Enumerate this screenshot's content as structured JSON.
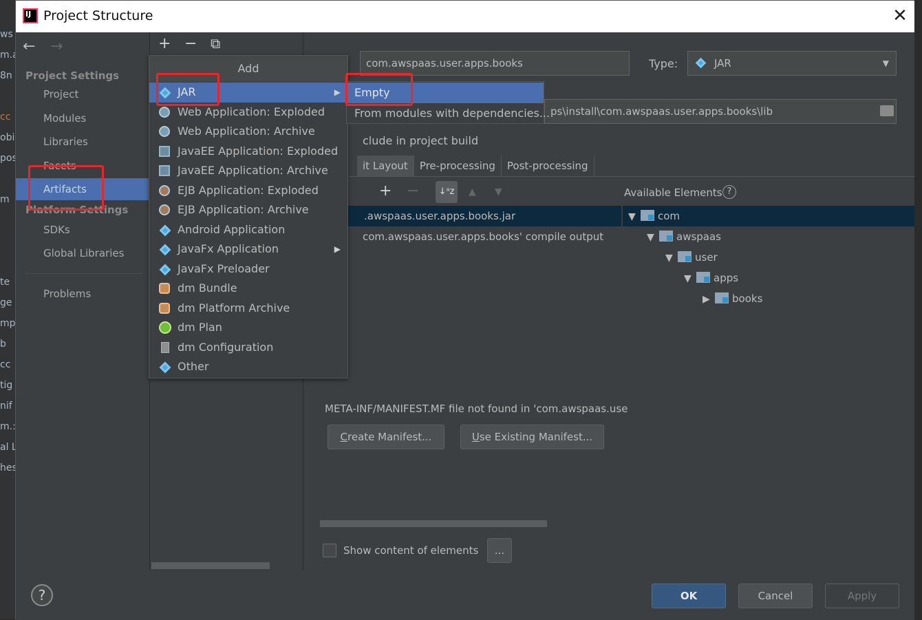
{
  "ide_background": {
    "left_fragments": [
      "ws",
      "m.a",
      "8n",
      "cc",
      "obil",
      "pos",
      "m",
      "te",
      "ge",
      "mp",
      "b",
      "cc",
      "tig",
      "nif",
      "m.:",
      "al L",
      "hes"
    ]
  },
  "dialog": {
    "title": "Project Structure",
    "close_glyph": "✕"
  },
  "nav": {
    "back_glyph": "←",
    "forward_glyph": "→",
    "project_settings_header": "Project Settings",
    "project_items": [
      "Project",
      "Modules",
      "Libraries",
      "Facets",
      "Artifacts"
    ],
    "selected": "Artifacts",
    "platform_settings_header": "Platform Settings",
    "platform_items": [
      "SDKs",
      "Global Libraries"
    ],
    "problems": "Problems"
  },
  "artifacts_toolbar": {
    "add_glyph": "+",
    "remove_glyph": "−",
    "copy_glyph": "⧉"
  },
  "add_popup": {
    "title": "Add",
    "items": [
      {
        "label": "JAR",
        "icon": "jar-icon",
        "submenu": true,
        "selected": true
      },
      {
        "label": "Web Application: Exploded",
        "icon": "web-app-icon"
      },
      {
        "label": "Web Application: Archive",
        "icon": "web-app-icon"
      },
      {
        "label": "JavaEE Application: Exploded",
        "icon": "javaee-icon"
      },
      {
        "label": "JavaEE Application: Archive",
        "icon": "javaee-icon"
      },
      {
        "label": "EJB Application: Exploded",
        "icon": "ejb-icon"
      },
      {
        "label": "EJB Application: Archive",
        "icon": "ejb-icon"
      },
      {
        "label": "Android Application",
        "icon": "android-icon"
      },
      {
        "label": "JavaFx Application",
        "icon": "javafx-icon",
        "submenu": true
      },
      {
        "label": "JavaFx Preloader",
        "icon": "javafx-icon"
      },
      {
        "label": "dm Bundle",
        "icon": "bundle-icon"
      },
      {
        "label": "dm Platform Archive",
        "icon": "bundle-icon"
      },
      {
        "label": "dm Plan",
        "icon": "plan-icon"
      },
      {
        "label": "dm Configuration",
        "icon": "config-icon"
      },
      {
        "label": "Other",
        "icon": "other-icon"
      }
    ],
    "submenu_arrow": "▶"
  },
  "jar_submenu": {
    "items": [
      "Empty",
      "From modules with dependencies..."
    ],
    "selected": "Empty"
  },
  "artifact": {
    "name": "com.awspaas.user.apps.books",
    "type_label": "Type:",
    "type_value": "JAR",
    "output_dir": "ps\\install\\com.awspaas.user.apps.books\\lib",
    "include_build_label": "clude in project build",
    "tabs": [
      "it Layout",
      "Pre-processing",
      "Post-processing"
    ],
    "selected_tab": "it Layout",
    "layout_toolbar": {
      "add": "+",
      "remove": "−",
      "sort": "↓ᵃz",
      "up": "▲",
      "down": "▼"
    },
    "output_tree": [
      ".awspaas.user.apps.books.jar",
      "com.awspaas.user.apps.books' compile output"
    ],
    "available_label": "Available Elements",
    "available_help": "?",
    "available_tree": [
      {
        "label": "com",
        "depth": 0,
        "expanded": true
      },
      {
        "label": "awspaas",
        "depth": 1,
        "expanded": true
      },
      {
        "label": "user",
        "depth": 2,
        "expanded": true
      },
      {
        "label": "apps",
        "depth": 3,
        "expanded": true
      },
      {
        "label": "books",
        "depth": 4,
        "expanded": false
      }
    ],
    "manifest_msg": "META-INF/MANIFEST.MF file not found in 'com.awspaas.use",
    "create_manifest_u": "C",
    "create_manifest_rest": "reate Manifest...",
    "use_manifest_u": "U",
    "use_manifest_rest": "se Existing Manifest...",
    "show_content_label": "Show content of elements",
    "ellipsis_btn": "..."
  },
  "footer": {
    "help": "?",
    "ok": "OK",
    "cancel": "Cancel",
    "apply": "Apply"
  },
  "colors": {
    "selection": "#4b6eaf",
    "panel": "#3c3f41",
    "annotation_red": "#e8262b",
    "primary_button": "#365880"
  }
}
